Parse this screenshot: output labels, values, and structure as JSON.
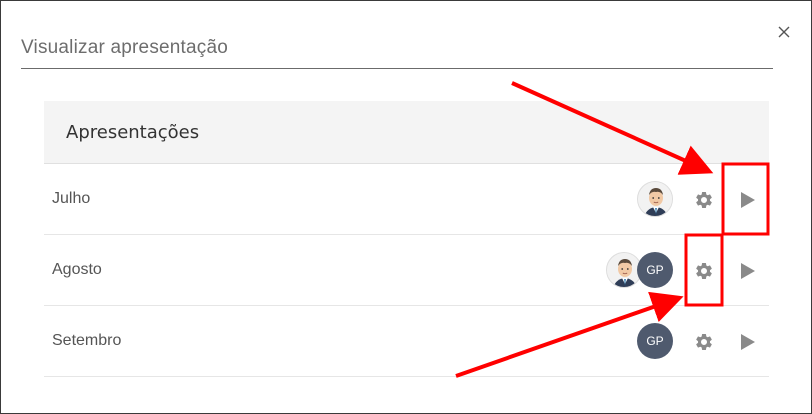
{
  "dialog": {
    "title_field_value": "Visualizar apresentação",
    "close_glyph": "×"
  },
  "table": {
    "header": "Apresentações",
    "rows": [
      {
        "label": "Julho",
        "avatars": [
          "photo"
        ]
      },
      {
        "label": "Agosto",
        "avatars": [
          "photo",
          "GP"
        ]
      },
      {
        "label": "Setembro",
        "avatars": [
          "GP"
        ]
      }
    ]
  },
  "avatar_initials": "GP",
  "icons": {
    "close": "close-icon",
    "settings": "gear-icon",
    "present": "play-icon"
  },
  "colors": {
    "annotation_red": "#ff0000",
    "avatar_initials_bg": "#4f5a6e",
    "icon_gray": "#8a8a8a"
  }
}
